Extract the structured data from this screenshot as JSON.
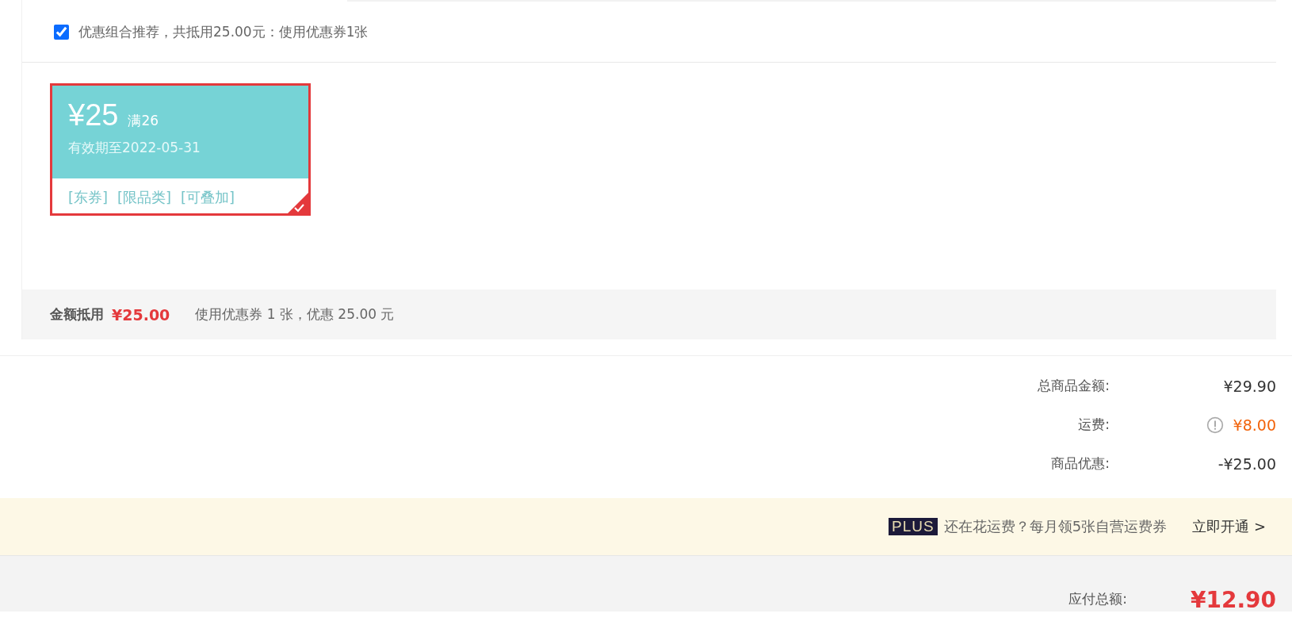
{
  "recommend": {
    "checked": true,
    "label": "优惠组合推荐，共抵用25.00元：使用优惠券1张"
  },
  "coupons": [
    {
      "amount": "¥25",
      "threshold": "满26",
      "validity": "有效期至2022-05-31",
      "tags": [
        "[东券]",
        "[限品类]",
        "[可叠加]"
      ],
      "selected": true
    }
  ],
  "deduction": {
    "label": "金额抵用",
    "amount": "¥25.00",
    "note": "使用优惠券 1 张，优惠 25.00 元"
  },
  "summary": [
    {
      "label": "总商品金额:",
      "value": "¥29.90",
      "kind": "plain"
    },
    {
      "label": "运费:",
      "value": "¥8.00",
      "kind": "info"
    },
    {
      "label": "商品优惠:",
      "value": "-¥25.00",
      "kind": "plain"
    }
  ],
  "plus": {
    "badge": "PLUS",
    "text": "还在花运费？每月领5张自营运费券",
    "action": "立即开通 >"
  },
  "total": {
    "label": "应付总额:",
    "value": "¥12.90"
  }
}
